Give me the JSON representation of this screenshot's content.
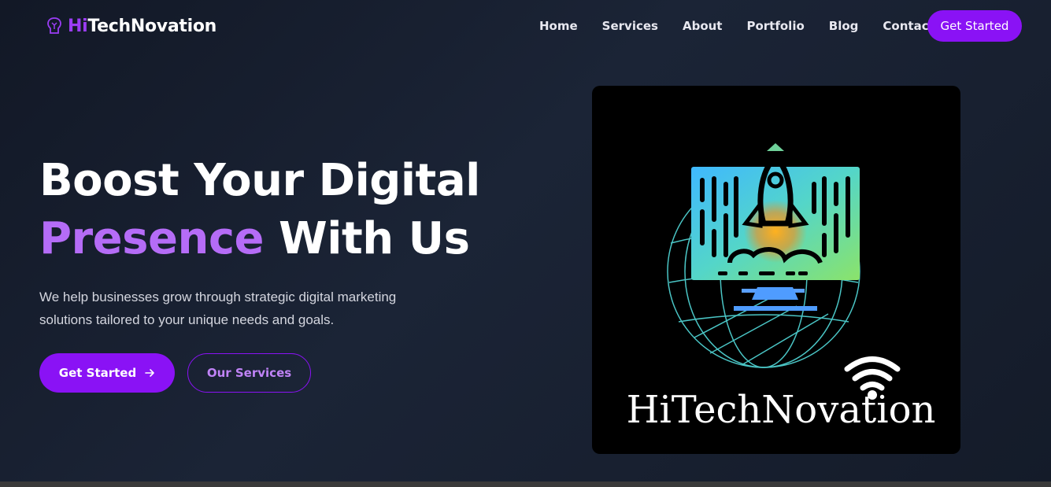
{
  "brand": {
    "prefix": "Hi",
    "suffix": "TechNovation",
    "icon": "brain-icon"
  },
  "nav": {
    "links": [
      "Home",
      "Services",
      "About",
      "Portfolio",
      "Blog",
      "Contact"
    ],
    "cta": "Get Started"
  },
  "hero": {
    "title_line1": "Boost Your Digital",
    "title_accent": "Presence",
    "title_rest": " With Us",
    "subtitle": "We help businesses grow through strategic digital marketing solutions tailored to your unique needs and goals.",
    "primary_button": "Get Started",
    "primary_icon": "arrow-right-icon",
    "secondary_button": "Our Services"
  },
  "image": {
    "logo_text": "HiTechNovation",
    "icons": [
      "rocket-icon",
      "monitor-icon",
      "globe-icon",
      "wifi-icon"
    ]
  },
  "colors": {
    "accent": "#8a12f5",
    "accent_light": "#b56cf7",
    "background": "#1b2436"
  }
}
